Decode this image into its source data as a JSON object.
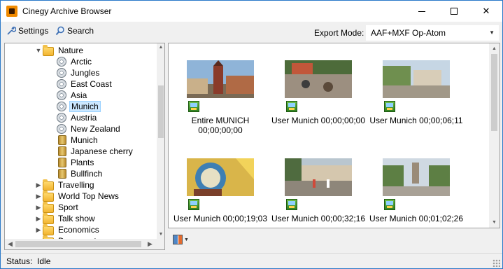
{
  "window": {
    "title": "Cinegy Archive Browser"
  },
  "toolbar": {
    "settings_label": "Settings",
    "search_label": "Search",
    "export_mode_label": "Export Mode:",
    "export_mode_value": "AAF+MXF Op-Atom"
  },
  "tree": {
    "items": [
      {
        "label": "Nature",
        "type": "folder",
        "expander": "▼",
        "level": 0
      },
      {
        "label": "Arctic",
        "type": "reel",
        "expander": "",
        "level": 1
      },
      {
        "label": "Jungles",
        "type": "reel",
        "expander": "",
        "level": 1
      },
      {
        "label": "East Coast",
        "type": "reel",
        "expander": "",
        "level": 1
      },
      {
        "label": "Asia",
        "type": "reel",
        "expander": "",
        "level": 1
      },
      {
        "label": "Munich",
        "type": "reel",
        "expander": "",
        "level": 1,
        "selected": true
      },
      {
        "label": "Austria",
        "type": "reel",
        "expander": "",
        "level": 1
      },
      {
        "label": "New Zealand",
        "type": "reel",
        "expander": "",
        "level": 1
      },
      {
        "label": "Munich",
        "type": "bin",
        "expander": "",
        "level": 1
      },
      {
        "label": "Japanese cherry",
        "type": "bin",
        "expander": "",
        "level": 1
      },
      {
        "label": "Plants",
        "type": "bin",
        "expander": "",
        "level": 1
      },
      {
        "label": "Bullfinch",
        "type": "bin",
        "expander": "",
        "level": 1
      },
      {
        "label": "Travelling",
        "type": "folder",
        "expander": "▶",
        "level": 0
      },
      {
        "label": "World Top News",
        "type": "folder",
        "expander": "▶",
        "level": 0
      },
      {
        "label": "Sport",
        "type": "folder",
        "expander": "▶",
        "level": 0
      },
      {
        "label": "Talk show",
        "type": "folder",
        "expander": "▶",
        "level": 0
      },
      {
        "label": "Economics",
        "type": "folder",
        "expander": "▶",
        "level": 0
      },
      {
        "label": "Documentary",
        "type": "folder",
        "expander": "▶",
        "level": 0
      }
    ]
  },
  "gallery": {
    "clips": [
      {
        "label": "Entire MUNICH\n00;00;00;00",
        "scene": "tower"
      },
      {
        "label": "User Munich 00;00;00;00",
        "scene": "plaza"
      },
      {
        "label": "User Munich 00;00;06;11",
        "scene": "street"
      },
      {
        "label": "User Munich 00;00;19;03",
        "scene": "crest"
      },
      {
        "label": "User Munich 00;00;32;16",
        "scene": "crowd"
      },
      {
        "label": "User Munich 00;01;02;26",
        "scene": "avenue"
      }
    ]
  },
  "status": {
    "text": "Status:  Idle"
  },
  "colors": {
    "selection": "#cce8ff",
    "window_border": "#2b79c9"
  }
}
